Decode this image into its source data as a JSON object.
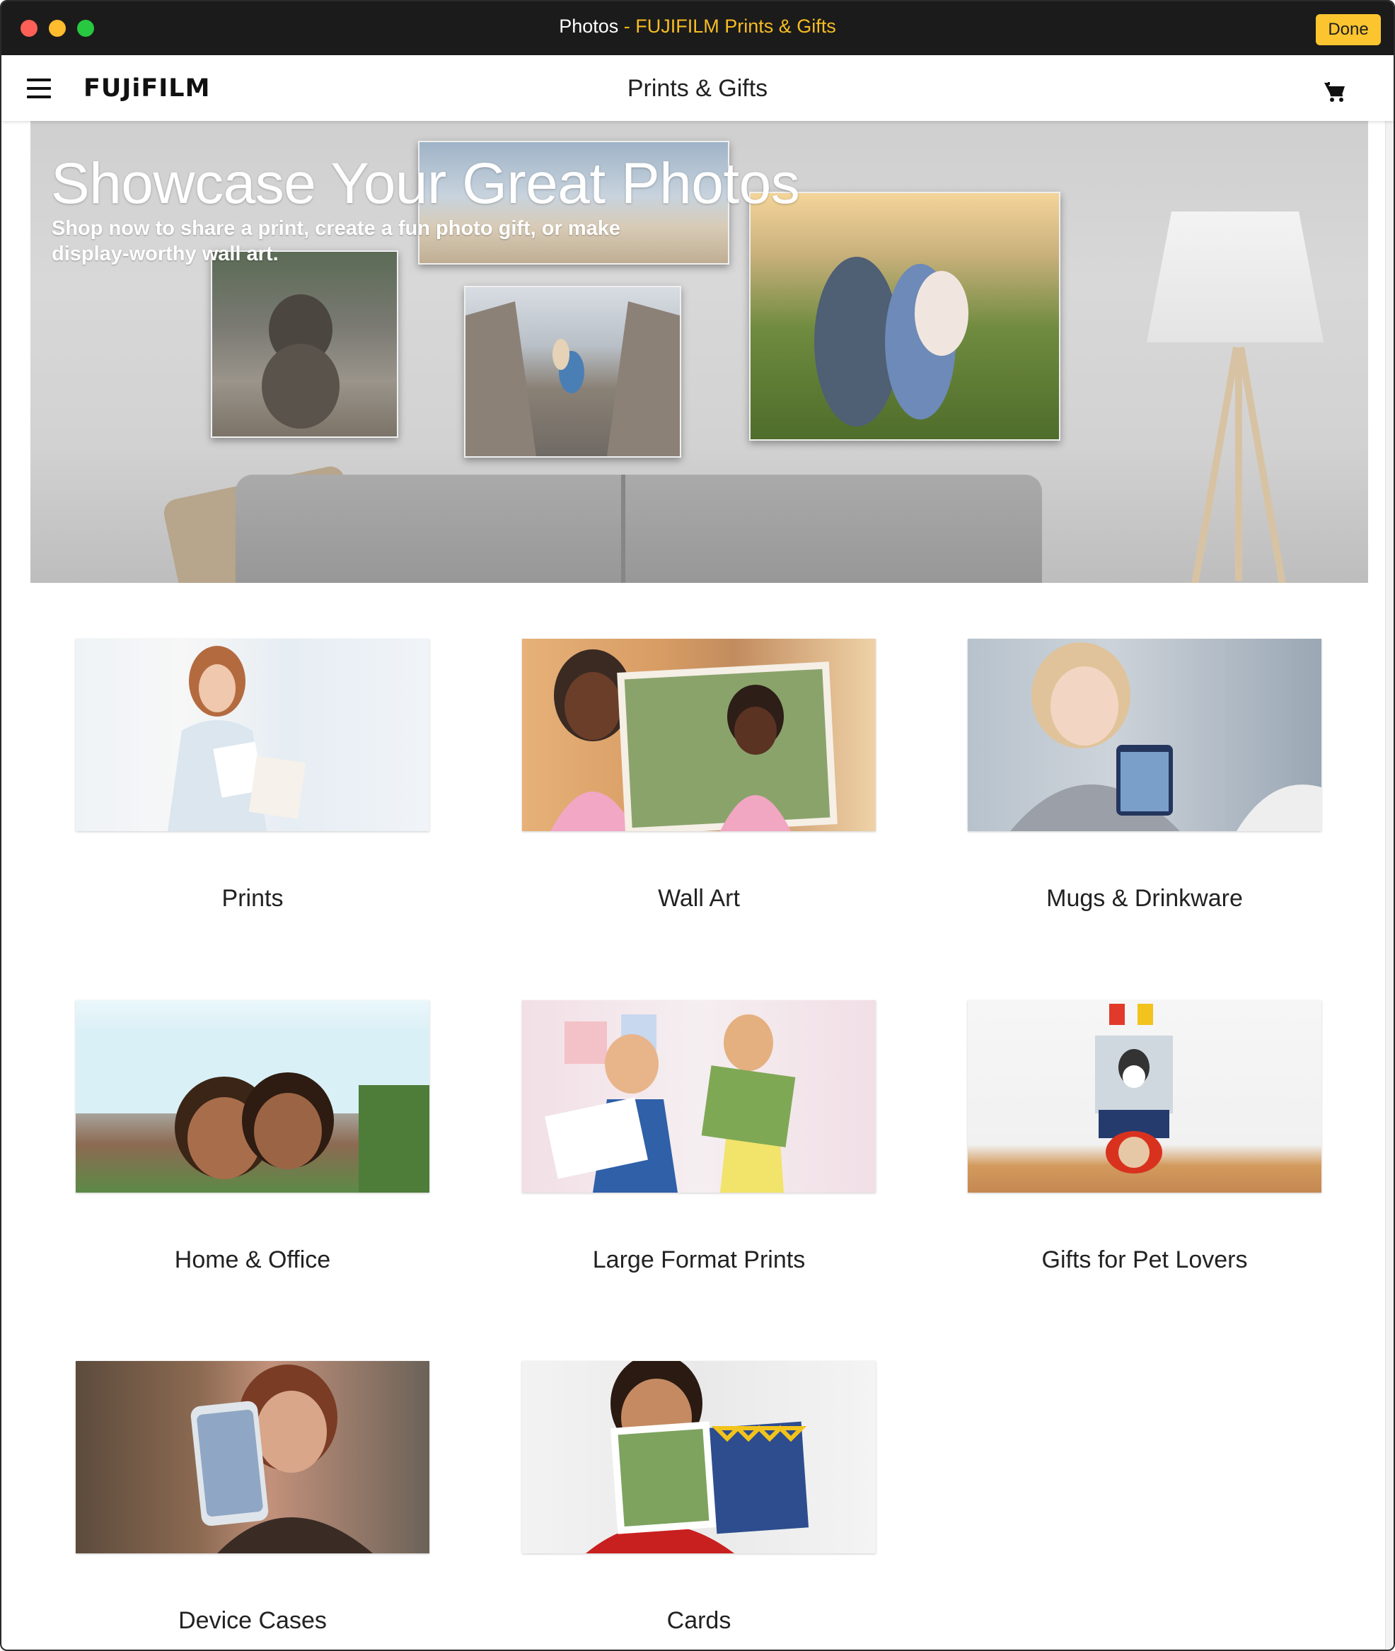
{
  "window": {
    "app_name": "Photos",
    "separator": " - ",
    "site_name": "FUJIFILM Prints & Gifts",
    "done_label": "Done"
  },
  "header": {
    "brand": "FUJiFILM",
    "title": "Prints & Gifts",
    "menu_icon": "hamburger-icon",
    "cart_icon": "cart-icon"
  },
  "hero": {
    "title": "Showcase Your Great Photos",
    "subtitle": "Shop now to share a print, create a fun photo gift, or make display-worthy wall art."
  },
  "categories": [
    {
      "label": "Prints"
    },
    {
      "label": "Wall Art"
    },
    {
      "label": "Mugs & Drinkware"
    },
    {
      "label": "Home & Office"
    },
    {
      "label": "Large Format Prints"
    },
    {
      "label": "Gifts for Pet Lovers"
    },
    {
      "label": "Device Cases"
    },
    {
      "label": "Cards"
    }
  ],
  "colors": {
    "titlebar": "#1b1b1b",
    "accent": "#fcc52f",
    "site_name": "#f7bd22"
  }
}
